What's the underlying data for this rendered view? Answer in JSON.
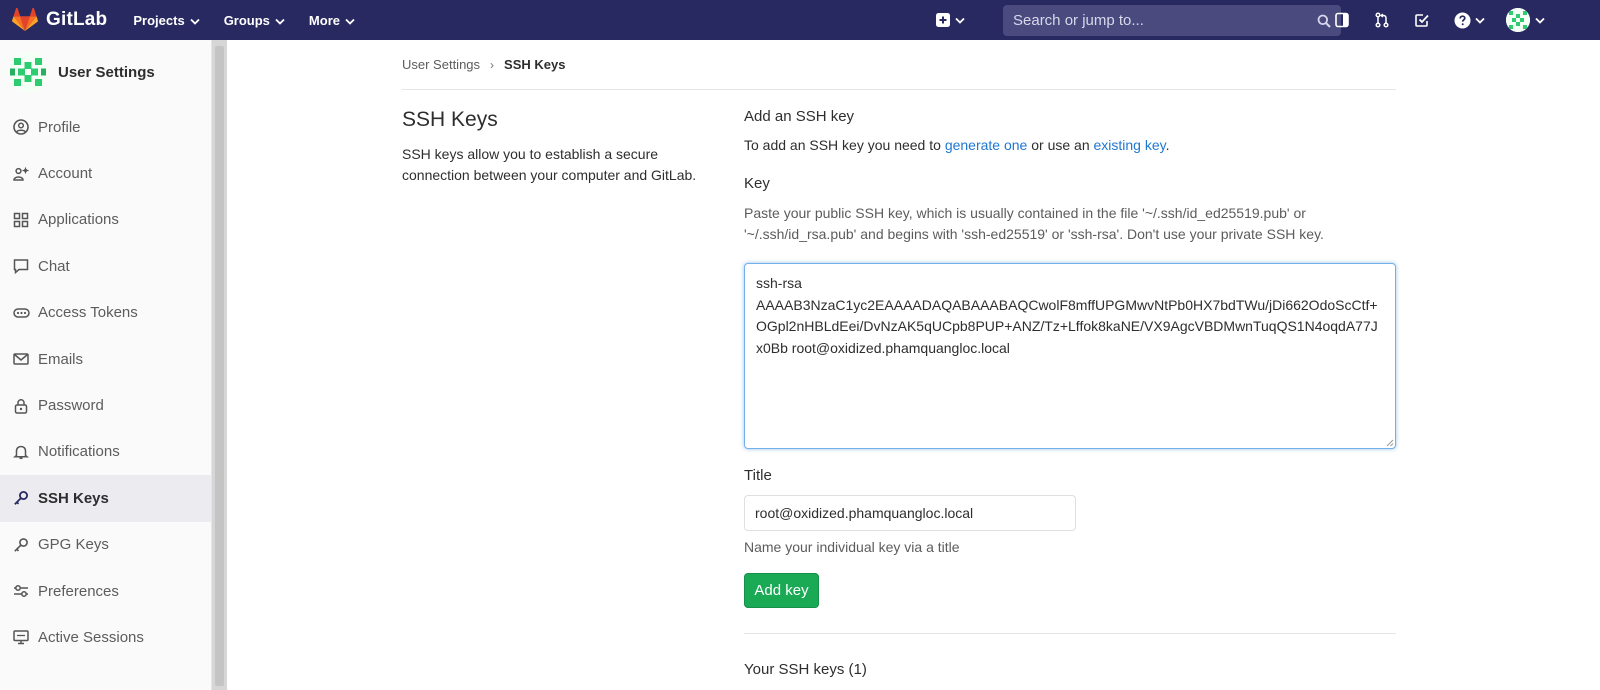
{
  "navbar": {
    "brand": "GitLab",
    "menu": [
      "Projects",
      "Groups",
      "More"
    ],
    "search_placeholder": "Search or jump to...",
    "icons": [
      "plus-square-icon",
      "sidebar-toggle-icon",
      "merge-request-icon",
      "todo-check-icon",
      "help-icon",
      "user-avatar"
    ]
  },
  "sidebar": {
    "title": "User Settings",
    "items": [
      {
        "label": "Profile",
        "icon": "profile-icon"
      },
      {
        "label": "Account",
        "icon": "account-icon"
      },
      {
        "label": "Applications",
        "icon": "applications-icon"
      },
      {
        "label": "Chat",
        "icon": "chat-icon"
      },
      {
        "label": "Access Tokens",
        "icon": "access-tokens-icon"
      },
      {
        "label": "Emails",
        "icon": "emails-icon"
      },
      {
        "label": "Password",
        "icon": "lock-icon"
      },
      {
        "label": "Notifications",
        "icon": "bell-icon"
      },
      {
        "label": "SSH Keys",
        "icon": "key-icon",
        "active": true
      },
      {
        "label": "GPG Keys",
        "icon": "key-icon"
      },
      {
        "label": "Preferences",
        "icon": "preferences-icon"
      },
      {
        "label": "Active Sessions",
        "icon": "monitor-icon"
      }
    ]
  },
  "breadcrumb": {
    "parent": "User Settings",
    "separator": "›",
    "current": "SSH Keys"
  },
  "intro": {
    "title": "SSH Keys",
    "description": "SSH keys allow you to establish a secure connection between your computer and GitLab."
  },
  "form": {
    "heading": "Add an SSH key",
    "intro_prefix": "To add an SSH key you need to ",
    "intro_link1": "generate one",
    "intro_middle": " or use an ",
    "intro_link2": "existing key",
    "intro_suffix": ".",
    "key_label": "Key",
    "key_help": "Paste your public SSH key, which is usually contained in the file '~/.ssh/id_ed25519.pub' or '~/.ssh/id_rsa.pub' and begins with 'ssh-ed25519' or 'ssh-rsa'. Don't use your private SSH key.",
    "key_value": "ssh-rsa\nAAAAB3NzaC1yc2EAAAADAQABAAABAQCwolF8mffUPGMwvNtPb0HX7bdTWu/jDi662OdoScCtf+OGpl2nHBLdEei/DvNzAK5qUCpb8PUP+ANZ/Tz+Lffok8kaNE/VX9AgcVBDMwnTuqQS1N4oqdA77Jx0Bb root@oxidized.phamquangloc.local\n",
    "title_label": "Title",
    "title_value": "root@oxidized.phamquangloc.local",
    "title_help": "Name your individual key via a title",
    "submit_label": "Add key"
  },
  "keys_list": {
    "heading": "Your SSH keys (1)"
  },
  "colors": {
    "navbar": "#292961",
    "accent_link": "#1f78d1",
    "submit_green": "#1aaa55"
  }
}
